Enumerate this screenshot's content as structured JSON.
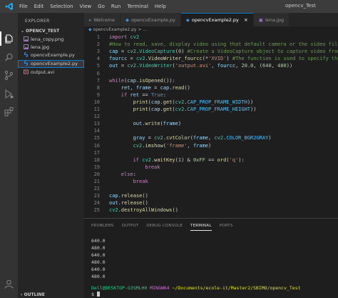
{
  "window": {
    "title": "opencv_Test",
    "menu": [
      "File",
      "Edit",
      "Selection",
      "View",
      "Go",
      "Run",
      "Terminal",
      "Help"
    ]
  },
  "activity_bar": {
    "icons": [
      "files-icon",
      "search-icon",
      "source-control-icon",
      "run-debug-icon",
      "extensions-icon",
      "account-icon"
    ]
  },
  "explorer": {
    "header": "EXPLORER",
    "folder": "OPENCV_TEST",
    "files": [
      {
        "name": "lena_copy.png",
        "icon": "image-file-icon"
      },
      {
        "name": "lena.jpg",
        "icon": "image-file-icon"
      },
      {
        "name": "opencvExample.py",
        "icon": "python-file-icon"
      },
      {
        "name": "opencvExample2.py",
        "icon": "python-file-icon",
        "selected": true
      },
      {
        "name": "output.avi",
        "icon": "video-file-icon"
      }
    ],
    "outline": "OUTLINE"
  },
  "tabs": [
    {
      "label": "Welcome",
      "active": false
    },
    {
      "label": "opencvExample.py",
      "active": false
    },
    {
      "label": "opencvExample2.py",
      "active": true
    },
    {
      "label": "lena.jpg",
      "active": false
    }
  ],
  "breadcrumb": "opencvExample2.py > ...",
  "code_lines": [
    {
      "n": "1",
      "indent": 0,
      "tokens": [
        [
          "kw",
          "import "
        ],
        [
          "mod",
          "cv2"
        ]
      ]
    },
    {
      "n": "2",
      "indent": 0,
      "tokens": [
        [
          "cmt",
          "#How to read, save, display video using that default camera or the video fil"
        ]
      ]
    },
    {
      "n": "3",
      "indent": 0,
      "tokens": [
        [
          "var",
          "cap"
        ],
        [
          "pl",
          " = "
        ],
        [
          "mod",
          "cv2"
        ],
        [
          "pl",
          "."
        ],
        [
          "mod",
          "VideoCapture"
        ],
        [
          "pl",
          "("
        ],
        [
          "num",
          "0"
        ],
        [
          "pl",
          ") "
        ],
        [
          "cmt",
          "#Create a VideoCapture object to capture video from"
        ]
      ]
    },
    {
      "n": "4",
      "indent": 0,
      "tokens": [
        [
          "var",
          "fourcc"
        ],
        [
          "pl",
          " = "
        ],
        [
          "mod",
          "cv2"
        ],
        [
          "pl",
          "."
        ],
        [
          "fn",
          "VideoWriter_fourcc"
        ],
        [
          "pl",
          "(*"
        ],
        [
          "str",
          "'XVID'"
        ],
        [
          "pl",
          ") "
        ],
        [
          "cmt",
          "#The function is used to specify the"
        ]
      ]
    },
    {
      "n": "5",
      "indent": 0,
      "tokens": [
        [
          "var",
          "out"
        ],
        [
          "pl",
          " = "
        ],
        [
          "mod",
          "cv2"
        ],
        [
          "pl",
          "."
        ],
        [
          "mod",
          "VideoWriter"
        ],
        [
          "pl",
          "("
        ],
        [
          "str",
          "'output.avi'"
        ],
        [
          "pl",
          ", "
        ],
        [
          "var",
          "fourcc"
        ],
        [
          "pl",
          ", "
        ],
        [
          "num",
          "20.0"
        ],
        [
          "pl",
          ", ("
        ],
        [
          "num",
          "640"
        ],
        [
          "pl",
          ", "
        ],
        [
          "num",
          "480"
        ],
        [
          "pl",
          "))"
        ]
      ]
    },
    {
      "n": "6",
      "indent": 0,
      "tokens": []
    },
    {
      "n": "7",
      "indent": 0,
      "tokens": [
        [
          "kw",
          "while"
        ],
        [
          "pl",
          "("
        ],
        [
          "var",
          "cap"
        ],
        [
          "pl",
          "."
        ],
        [
          "fn",
          "isOpened"
        ],
        [
          "pl",
          "()):"
        ]
      ]
    },
    {
      "n": "8",
      "indent": 1,
      "tokens": [
        [
          "var",
          "ret"
        ],
        [
          "pl",
          ", "
        ],
        [
          "var",
          "frame"
        ],
        [
          "pl",
          " = "
        ],
        [
          "var",
          "cap"
        ],
        [
          "pl",
          "."
        ],
        [
          "fn",
          "read"
        ],
        [
          "pl",
          "()"
        ]
      ]
    },
    {
      "n": "9",
      "indent": 1,
      "tokens": [
        [
          "kw",
          "if "
        ],
        [
          "var",
          "ret"
        ],
        [
          "pl",
          " == "
        ],
        [
          "bool",
          "True"
        ],
        [
          "pl",
          ":"
        ]
      ]
    },
    {
      "n": "10",
      "indent": 2,
      "tokens": [
        [
          "fn",
          "print"
        ],
        [
          "pl",
          "("
        ],
        [
          "var",
          "cap"
        ],
        [
          "pl",
          "."
        ],
        [
          "fn",
          "get"
        ],
        [
          "pl",
          "("
        ],
        [
          "mod",
          "cv2"
        ],
        [
          "pl",
          "."
        ],
        [
          "const",
          "CAP_PROP_FRAME_WIDTH"
        ],
        [
          "pl",
          "))"
        ]
      ]
    },
    {
      "n": "11",
      "indent": 2,
      "tokens": [
        [
          "fn",
          "print"
        ],
        [
          "pl",
          "("
        ],
        [
          "var",
          "cap"
        ],
        [
          "pl",
          "."
        ],
        [
          "fn",
          "get"
        ],
        [
          "pl",
          "("
        ],
        [
          "mod",
          "cv2"
        ],
        [
          "pl",
          "."
        ],
        [
          "const",
          "CAP_PROP_FRAME_HEIGHT"
        ],
        [
          "pl",
          "))"
        ]
      ]
    },
    {
      "n": "12",
      "indent": 0,
      "tokens": []
    },
    {
      "n": "13",
      "indent": 2,
      "tokens": [
        [
          "var",
          "out"
        ],
        [
          "pl",
          "."
        ],
        [
          "fn",
          "write"
        ],
        [
          "pl",
          "("
        ],
        [
          "var",
          "frame"
        ],
        [
          "pl",
          ")"
        ]
      ]
    },
    {
      "n": "14",
      "indent": 0,
      "tokens": []
    },
    {
      "n": "15",
      "indent": 2,
      "tokens": [
        [
          "var",
          "gray"
        ],
        [
          "pl",
          " = "
        ],
        [
          "mod",
          "cv2"
        ],
        [
          "pl",
          "."
        ],
        [
          "fn",
          "cvtColor"
        ],
        [
          "pl",
          "("
        ],
        [
          "var",
          "frame"
        ],
        [
          "pl",
          ", "
        ],
        [
          "mod",
          "cv2"
        ],
        [
          "pl",
          "."
        ],
        [
          "const",
          "COLOR_BGR2GRAY"
        ],
        [
          "pl",
          ")"
        ]
      ]
    },
    {
      "n": "16",
      "indent": 2,
      "tokens": [
        [
          "mod",
          "cv2"
        ],
        [
          "pl",
          "."
        ],
        [
          "fn",
          "imshow"
        ],
        [
          "pl",
          "("
        ],
        [
          "str",
          "'frame'"
        ],
        [
          "pl",
          ", "
        ],
        [
          "var",
          "frame"
        ],
        [
          "pl",
          ")"
        ]
      ]
    },
    {
      "n": "17",
      "indent": 0,
      "tokens": []
    },
    {
      "n": "18",
      "indent": 2,
      "tokens": [
        [
          "kw",
          "if "
        ],
        [
          "mod",
          "cv2"
        ],
        [
          "pl",
          "."
        ],
        [
          "fn",
          "waitKey"
        ],
        [
          "pl",
          "("
        ],
        [
          "num",
          "1"
        ],
        [
          "pl",
          ") & "
        ],
        [
          "num",
          "0xFF"
        ],
        [
          "pl",
          " == "
        ],
        [
          "fn",
          "ord"
        ],
        [
          "pl",
          "("
        ],
        [
          "str",
          "'q'"
        ],
        [
          "pl",
          "):"
        ]
      ]
    },
    {
      "n": "19",
      "indent": 3,
      "tokens": [
        [
          "kw",
          "break"
        ]
      ]
    },
    {
      "n": "20",
      "indent": 1,
      "tokens": [
        [
          "kw",
          "else"
        ],
        [
          "pl",
          ":"
        ]
      ]
    },
    {
      "n": "21",
      "indent": 2,
      "tokens": [
        [
          "kw",
          "break"
        ]
      ]
    },
    {
      "n": "22",
      "indent": 0,
      "tokens": []
    },
    {
      "n": "23",
      "indent": 0,
      "tokens": [
        [
          "var",
          "cap"
        ],
        [
          "pl",
          "."
        ],
        [
          "fn",
          "release"
        ],
        [
          "pl",
          "()"
        ]
      ]
    },
    {
      "n": "24",
      "indent": 0,
      "tokens": [
        [
          "var",
          "out"
        ],
        [
          "pl",
          "."
        ],
        [
          "fn",
          "release"
        ],
        [
          "pl",
          "()"
        ]
      ]
    },
    {
      "n": "25",
      "indent": 0,
      "tokens": [
        [
          "mod",
          "cv2"
        ],
        [
          "pl",
          "."
        ],
        [
          "fn",
          "destroyAllWindows"
        ],
        [
          "pl",
          "()"
        ]
      ]
    }
  ],
  "panel": {
    "tabs": [
      {
        "label": "PROBLEMS",
        "active": false
      },
      {
        "label": "OUTPUT",
        "active": false
      },
      {
        "label": "DEBUG CONSOLE",
        "active": false
      },
      {
        "label": "TERMINAL",
        "active": true
      },
      {
        "label": "PORTS",
        "active": false
      }
    ],
    "terminal_lines": [
      "640.0",
      "480.0",
      "640.0",
      "480.0",
      "640.0",
      "480.0"
    ],
    "prompt": {
      "user": "Dell@DESKTOP-G3SMLH0",
      "shell": "MINGW64",
      "path": "~/Documents/ecole-it/Master2/SBIMO/opencv_Test",
      "symbol": "$"
    }
  },
  "colors": {
    "accent": "#007acc",
    "keyword": "#c586c0",
    "module": "#4ec9b0",
    "function": "#dcdcaa",
    "string": "#ce9178",
    "comment": "#6a9955"
  }
}
